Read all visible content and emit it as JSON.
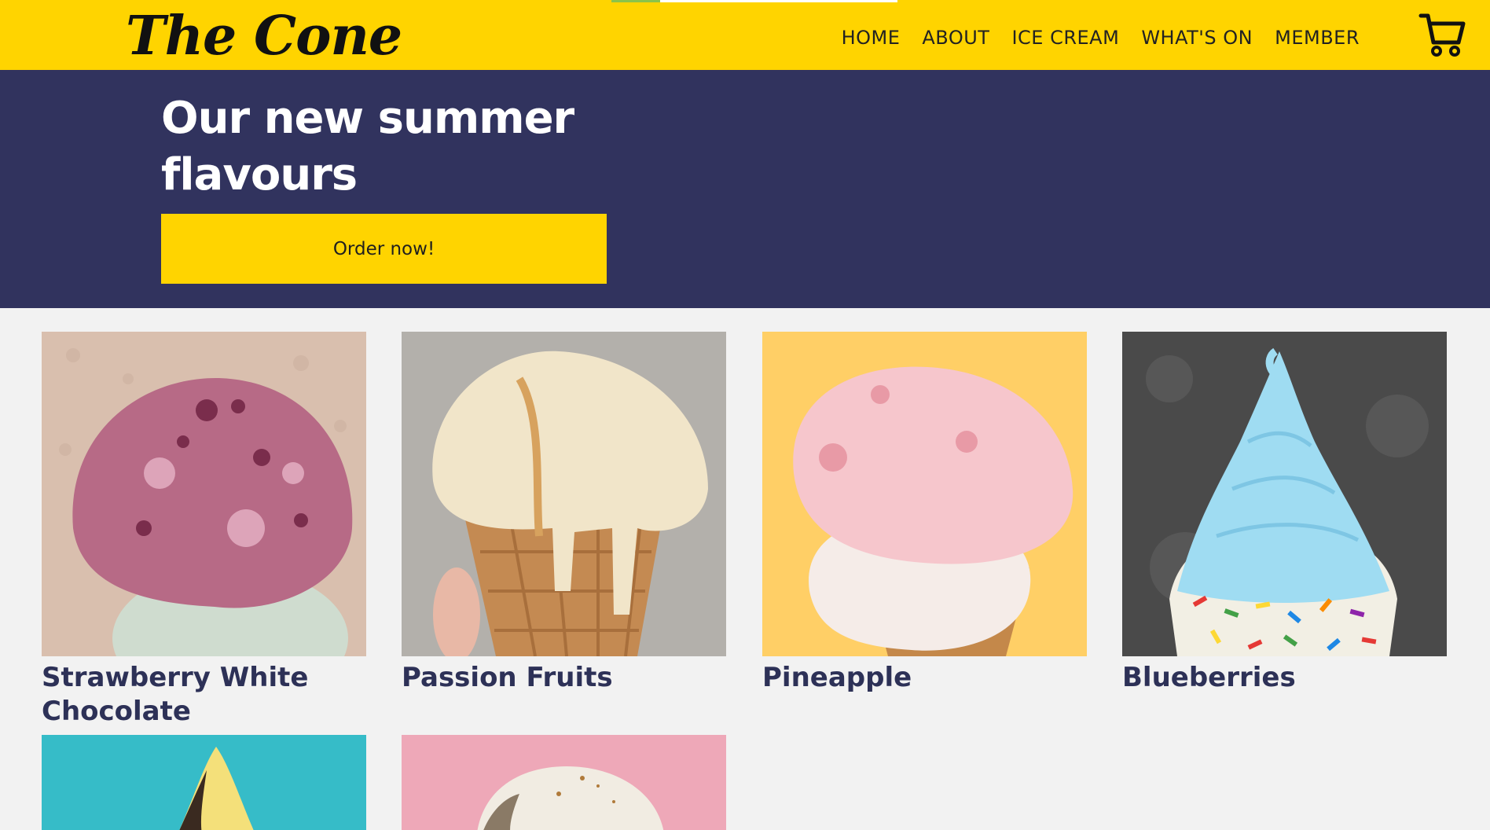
{
  "header": {
    "logo": "The Cone",
    "nav": [
      "HOME",
      "ABOUT",
      "ICE CREAM",
      "WHAT'S ON",
      "MEMBER"
    ],
    "cart_icon": "shopping-cart-icon",
    "load_progress": 0.17
  },
  "hero": {
    "title": "Our new summer flavours",
    "button": "Order now!"
  },
  "products": [
    {
      "name": "Strawberry White Chocolate",
      "image": "scoop-berry-ripple"
    },
    {
      "name": "Passion Fruits",
      "image": "cone-vanilla-caramel"
    },
    {
      "name": "Pineapple",
      "image": "cone-pink-scoop"
    },
    {
      "name": "Blueberries",
      "image": "soft-serve-blue-sprinkles"
    },
    {
      "name": "",
      "image": "cone-yellow-teal"
    },
    {
      "name": "",
      "image": "scoop-pink-background"
    }
  ],
  "colors": {
    "brand_yellow": "#ffd400",
    "hero_navy": "#31335e",
    "text_navy": "#2d3157",
    "page_bg": "#f2f2f2"
  }
}
